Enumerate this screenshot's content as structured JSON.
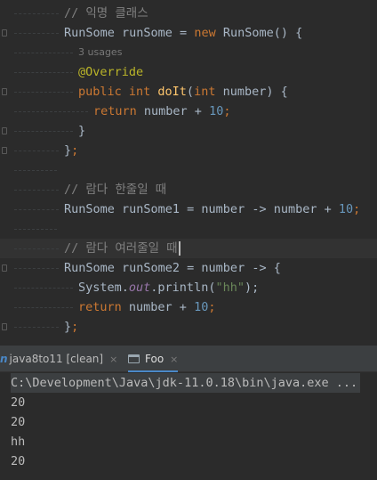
{
  "colors": {
    "comment": "#808080",
    "type": "#a9b7c6",
    "keyword": "#cc7832",
    "number": "#6897bb",
    "string": "#6a8759",
    "method": "#ffc66d",
    "annotation": "#bbb529",
    "field": "#9876aa",
    "default": "#a9b7c6",
    "hint": "#787878"
  },
  "code_lines": [
    {
      "indent": 4,
      "tokens": [
        {
          "t": "// 익명 클래스",
          "c": "comment"
        }
      ]
    },
    {
      "indent": 4,
      "tokens": [
        {
          "t": "RunSome",
          "c": "type"
        },
        {
          "t": " runSome = ",
          "c": "default"
        },
        {
          "t": "new",
          "c": "keyword"
        },
        {
          "t": " RunSome() {",
          "c": "default"
        }
      ]
    },
    {
      "indent": 6,
      "hint": true,
      "tokens": [
        {
          "t": "3 usages",
          "c": "hint"
        }
      ]
    },
    {
      "indent": 6,
      "tokens": [
        {
          "t": "@Override",
          "c": "annotation"
        }
      ]
    },
    {
      "indent": 6,
      "tokens": [
        {
          "t": "public int ",
          "c": "keyword"
        },
        {
          "t": "doIt",
          "c": "method"
        },
        {
          "t": "(",
          "c": "default"
        },
        {
          "t": "int ",
          "c": "keyword"
        },
        {
          "t": "number) {",
          "c": "default"
        }
      ]
    },
    {
      "indent": 8,
      "tokens": [
        {
          "t": "return ",
          "c": "keyword"
        },
        {
          "t": "number + ",
          "c": "default"
        },
        {
          "t": "10",
          "c": "number"
        },
        {
          "t": ";",
          "c": "keyword"
        }
      ]
    },
    {
      "indent": 6,
      "tokens": [
        {
          "t": "}",
          "c": "default"
        }
      ]
    },
    {
      "indent": 4,
      "tokens": [
        {
          "t": "}",
          "c": "default"
        },
        {
          "t": ";",
          "c": "keyword"
        }
      ]
    },
    {
      "indent": 0,
      "tokens": []
    },
    {
      "indent": 4,
      "tokens": [
        {
          "t": "// 람다 한줄일 때",
          "c": "comment"
        }
      ]
    },
    {
      "indent": 4,
      "tokens": [
        {
          "t": "RunSome runSome1 = number -> number + ",
          "c": "default"
        },
        {
          "t": "10",
          "c": "number"
        },
        {
          "t": ";",
          "c": "keyword"
        }
      ]
    },
    {
      "indent": 0,
      "tokens": []
    },
    {
      "indent": 4,
      "current": true,
      "tokens": [
        {
          "t": "// 람다 여러줄일 때",
          "c": "comment"
        }
      ]
    },
    {
      "indent": 4,
      "tokens": [
        {
          "t": "RunSome runSome2 = number -> {",
          "c": "default"
        }
      ]
    },
    {
      "indent": 6,
      "tokens": [
        {
          "t": "System.",
          "c": "default"
        },
        {
          "t": "out",
          "c": "field"
        },
        {
          "t": ".println(",
          "c": "default"
        },
        {
          "t": "\"hh\"",
          "c": "string"
        },
        {
          "t": ");",
          "c": "default"
        }
      ]
    },
    {
      "indent": 6,
      "tokens": [
        {
          "t": "return ",
          "c": "keyword"
        },
        {
          "t": "number + ",
          "c": "default"
        },
        {
          "t": "10",
          "c": "number"
        },
        {
          "t": ";",
          "c": "keyword"
        }
      ]
    },
    {
      "indent": 4,
      "tokens": [
        {
          "t": "}",
          "c": "default"
        },
        {
          "t": ";",
          "c": "keyword"
        }
      ]
    }
  ],
  "run_panel": {
    "tabs": [
      {
        "label": "java8to11 [clean]",
        "icon": "maven-icon",
        "close": "×"
      },
      {
        "label": "Foo",
        "icon": "run-config-icon",
        "close": "×"
      }
    ],
    "console": {
      "command": "C:\\Development\\Java\\jdk-11.0.18\\bin\\java.exe ...",
      "output": [
        "20",
        "20",
        "hh",
        "20"
      ]
    }
  }
}
